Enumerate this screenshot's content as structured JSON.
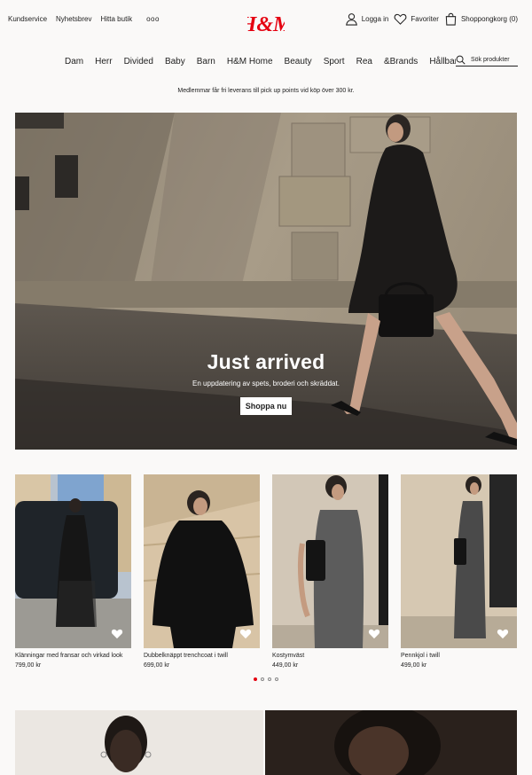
{
  "header": {
    "util_links": [
      "Kundservice",
      "Nyhetsbrev",
      "Hitta butik"
    ],
    "more_icon": "ooo",
    "logo_text": "H&M",
    "login": "Logga in",
    "favorites": "Favoriter",
    "cart": "Shoppongkorg (0)"
  },
  "nav": {
    "items": [
      "Dam",
      "Herr",
      "Divided",
      "Baby",
      "Barn",
      "H&M Home",
      "Beauty",
      "Sport",
      "Rea",
      "&Brands",
      "Hållbarhet"
    ],
    "search_placeholder": "Sök produkter"
  },
  "promo": "Medlemmar får fri leverans till pick up points vid köp över 300 kr.",
  "hero": {
    "title": "Just arrived",
    "subtitle": "En uppdatering av spets, broderi och skräddat.",
    "cta": "Shoppa nu"
  },
  "products": [
    {
      "name": "Klänningar med fransar och virkad look",
      "price": "799,00 kr"
    },
    {
      "name": "Dubbelknäppt trenchcoat i twill",
      "price": "699,00 kr"
    },
    {
      "name": "Kostymväst",
      "price": "449,00 kr"
    },
    {
      "name": "Pennkjol i twill",
      "price": "499,00 kr"
    }
  ],
  "carousel": {
    "pages": 4,
    "active": 0
  },
  "colors": {
    "brand": "#e50010",
    "text": "#222222",
    "background": "#faf9f8"
  }
}
